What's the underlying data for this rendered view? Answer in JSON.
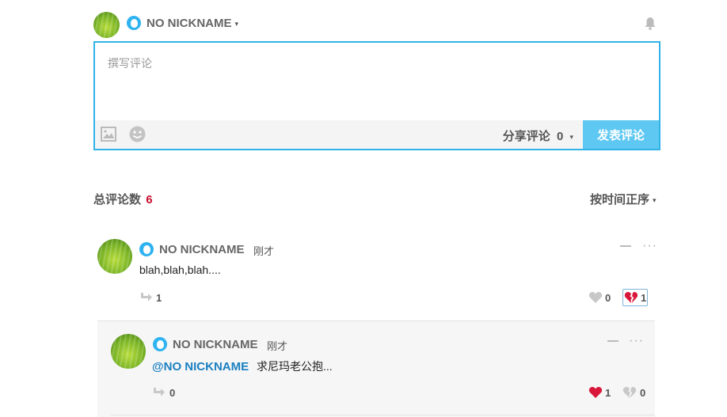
{
  "header": {
    "username": "NO NICKNAME",
    "caret": "▾"
  },
  "editor": {
    "placeholder": "撰写评论",
    "share_label": "分享评论",
    "share_count": "0",
    "share_caret": "▾",
    "submit_label": "发表评论"
  },
  "summary": {
    "total_label": "总评论数",
    "total_count": "6",
    "sort_label": "按时间正序",
    "sort_caret": "▾"
  },
  "comments": [
    {
      "username": "NO NICKNAME",
      "time": "刚才",
      "text": "blah,blah,blah....",
      "reply_count": "1",
      "like_count": "0",
      "dislike_count": "1"
    },
    {
      "username": "NO NICKNAME",
      "time": "刚才",
      "mention": "@NO NICKNAME",
      "text": "求尼玛老公抱...",
      "reply_count": "0",
      "like_count": "1",
      "dislike_count": "0"
    }
  ],
  "colors": {
    "accent": "#32b3e8",
    "submit_bg": "#5ec8f2",
    "count_red": "#c8102e",
    "mention": "#1a7fc1",
    "heart_red": "#d9173a"
  }
}
